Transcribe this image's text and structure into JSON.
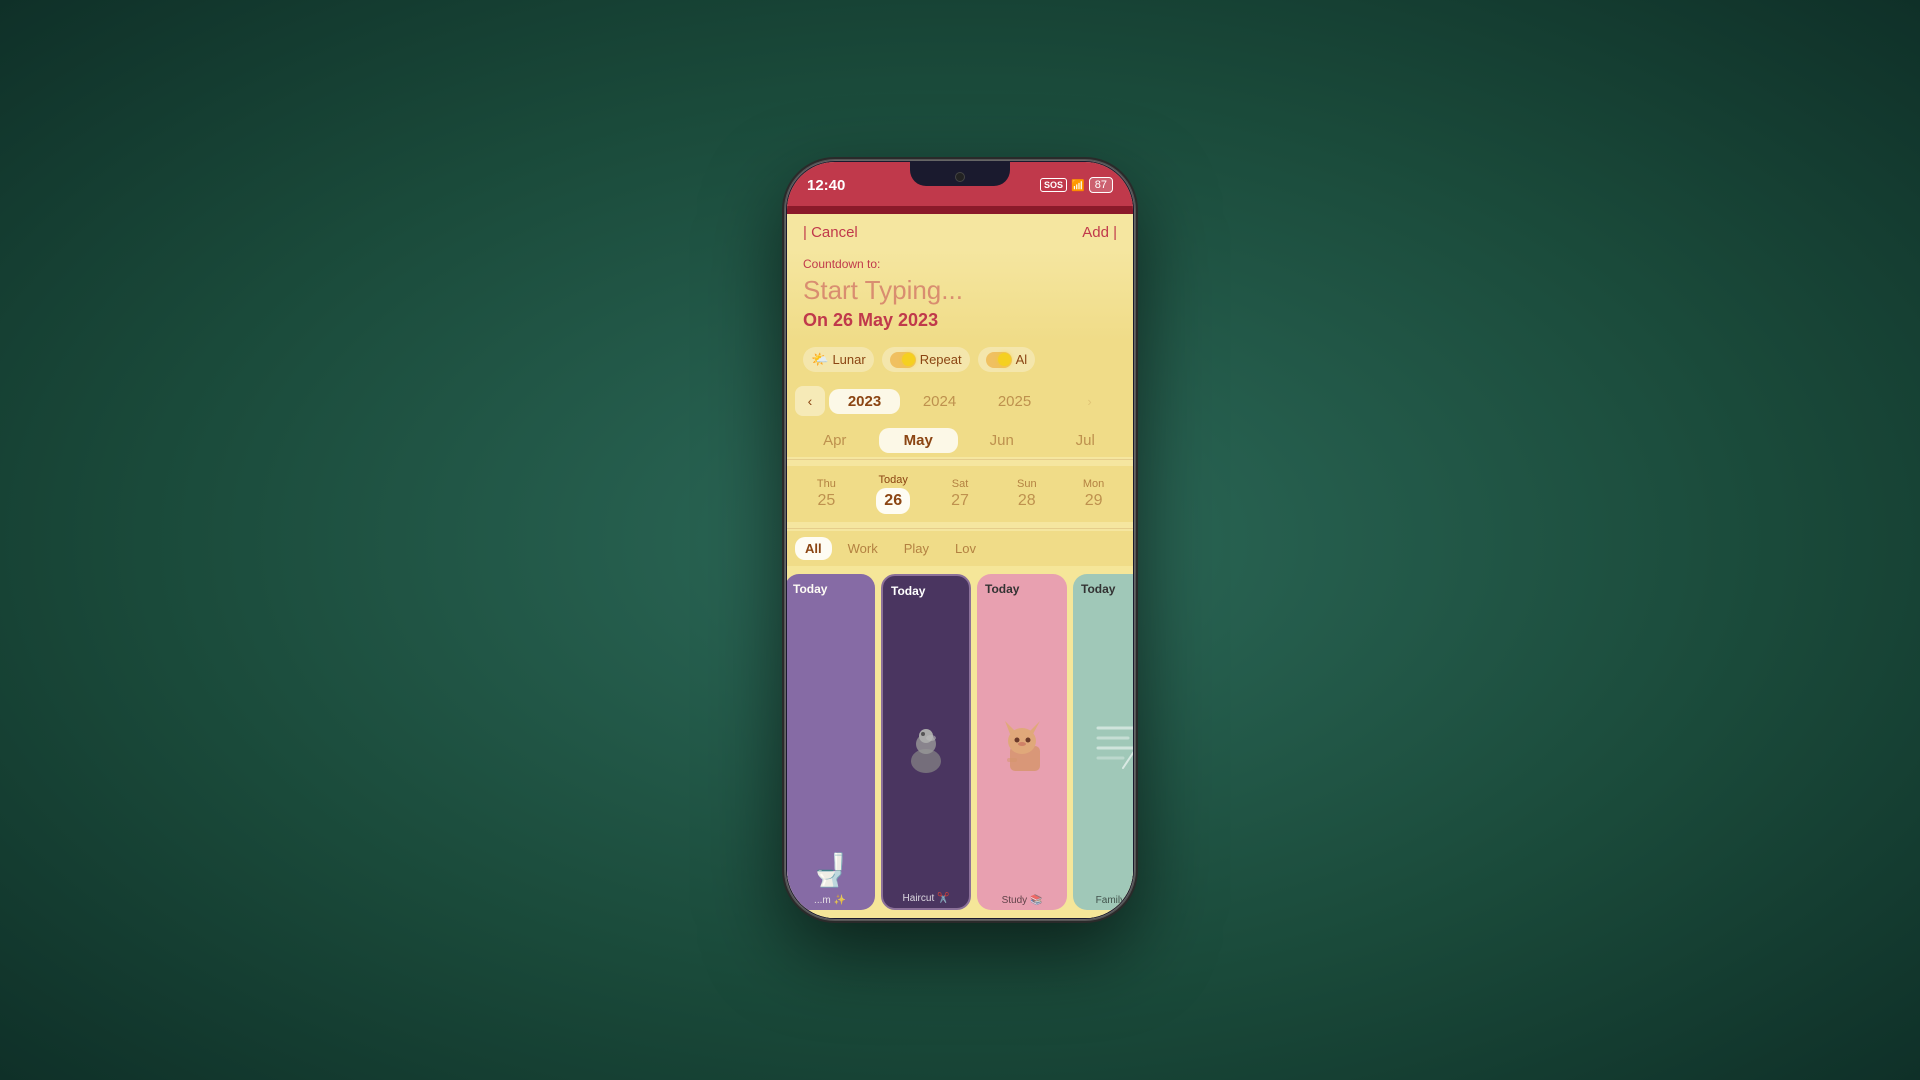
{
  "status_bar": {
    "time": "12:40",
    "sos": "SOS",
    "battery": "87"
  },
  "nav": {
    "cancel": "| Cancel",
    "add": "Add |"
  },
  "countdown": {
    "label": "Countdown to:",
    "placeholder": "Start Typing...",
    "date": "On 26 May 2023"
  },
  "toggles": [
    {
      "icon": "🌤️",
      "label": "Lunar",
      "state": "off"
    },
    {
      "icon": "🟡",
      "label": "Repeat",
      "state": "on"
    },
    {
      "icon": "🟡",
      "label": "Al",
      "state": "on"
    }
  ],
  "years": {
    "prev_nav": "‹",
    "items": [
      "2023",
      "2024",
      "2025"
    ],
    "selected": "2023"
  },
  "months": {
    "items": [
      "Apr",
      "May",
      "Jun",
      "Jul"
    ],
    "selected": "May"
  },
  "days": [
    {
      "label": "Thu",
      "num": "25",
      "selected": false
    },
    {
      "label": "Today",
      "num": "26",
      "selected": true
    },
    {
      "label": "Sat",
      "num": "27",
      "selected": false
    },
    {
      "label": "Sun",
      "num": "28",
      "selected": false
    },
    {
      "label": "Mon",
      "num": "29",
      "selected": false
    }
  ],
  "categories": {
    "items": [
      "All",
      "Work",
      "Play",
      "Lov"
    ],
    "selected": "All"
  },
  "cards": [
    {
      "id": "card1",
      "type": "purple",
      "title": "Today",
      "illustration": "toilet",
      "footer": "...m ✨",
      "partially_hidden": true
    },
    {
      "id": "card2",
      "type": "dark-purple",
      "title": "Today",
      "illustration": "bird",
      "footer": "Haircut ✂️",
      "partially_hidden": false,
      "selected": true
    },
    {
      "id": "card3",
      "type": "pink",
      "title": "Today",
      "illustration": "cat",
      "footer": "Study 📚",
      "partially_hidden": false
    },
    {
      "id": "card4",
      "type": "teal",
      "title": "Today",
      "illustration": "lines",
      "footer": "Family ✂️",
      "partially_hidden": true
    }
  ],
  "colors": {
    "accent": "#c0394b",
    "bg": "#f5e6a0",
    "card_bg_yellow": "#f0dc88"
  }
}
